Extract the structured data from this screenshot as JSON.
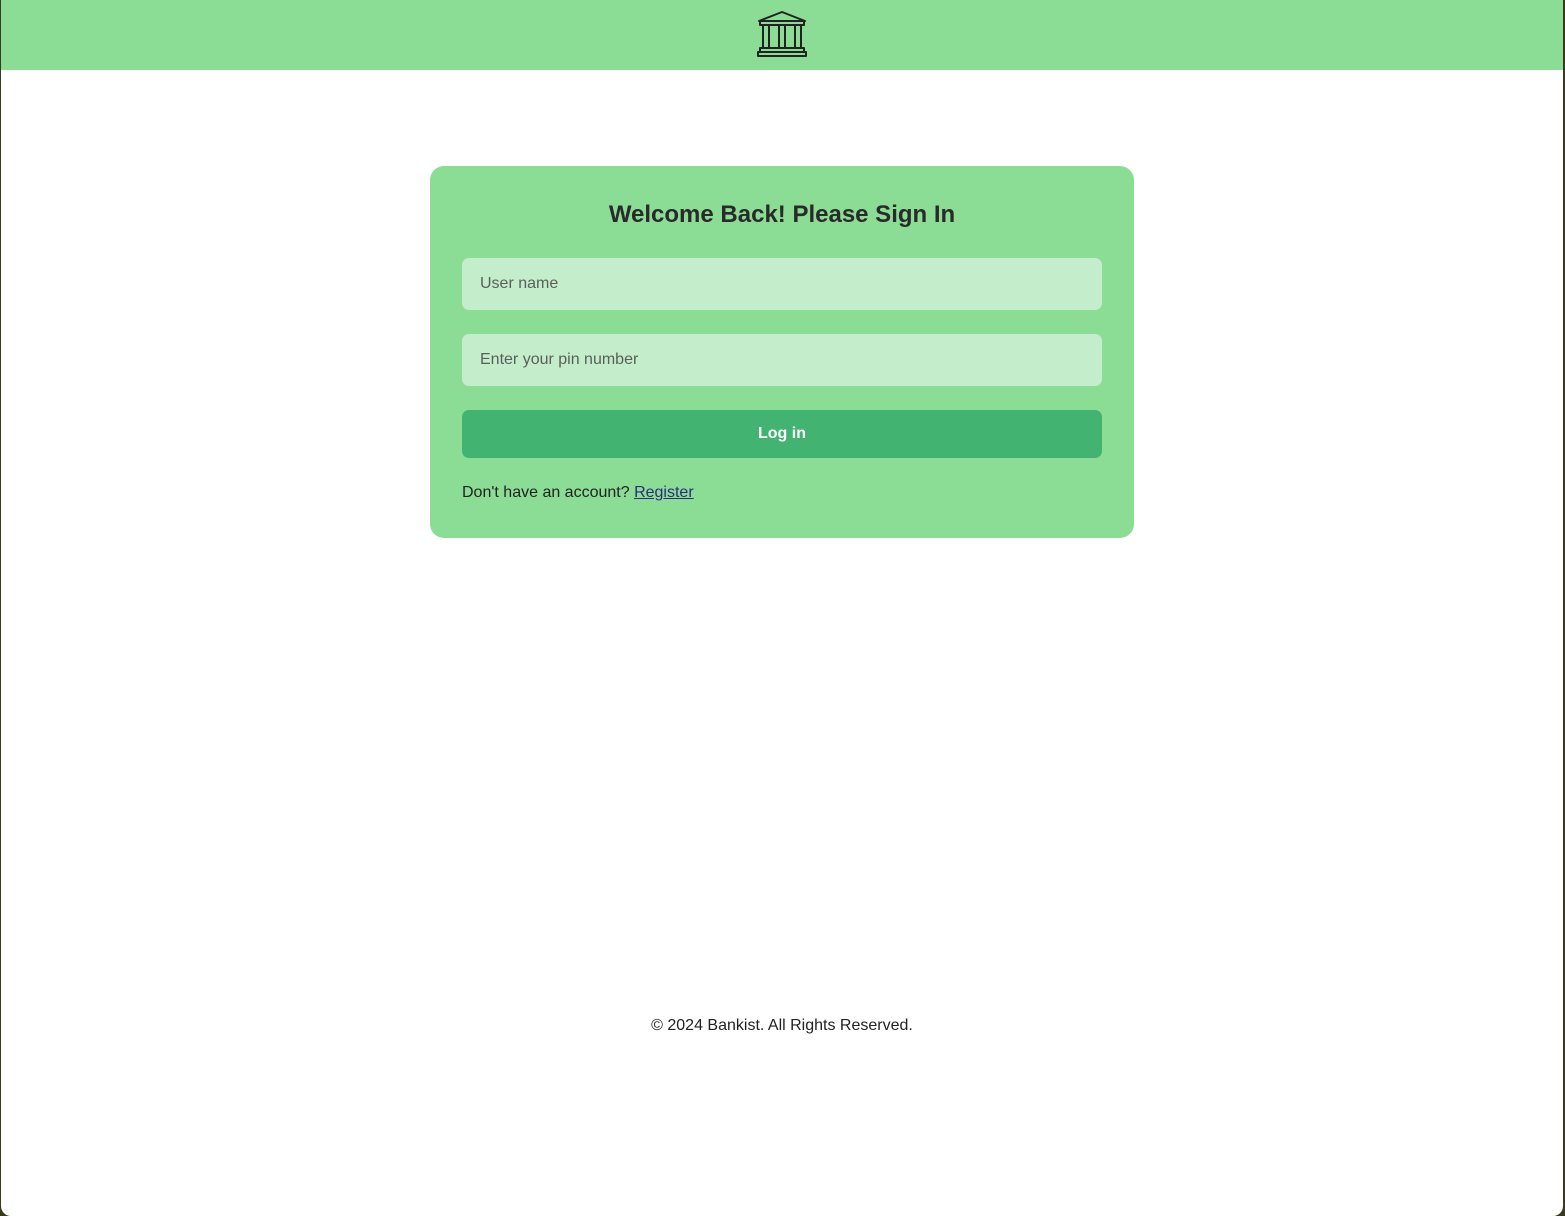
{
  "header": {
    "logo_icon": "bank-building-icon",
    "background_color": "#8bdd96"
  },
  "login_card": {
    "title": "Welcome Back! Please Sign In",
    "username_placeholder": "User name",
    "username_value": "",
    "pin_placeholder": "Enter your pin number",
    "pin_value": "",
    "login_button_label": "Log in",
    "register_prompt": "Don't have an account?",
    "register_link_label": "Register",
    "button_color": "#43b372",
    "input_color": "#c4edcb"
  },
  "footer": {
    "copyright": "© 2024 Bankist. All Rights Reserved."
  }
}
